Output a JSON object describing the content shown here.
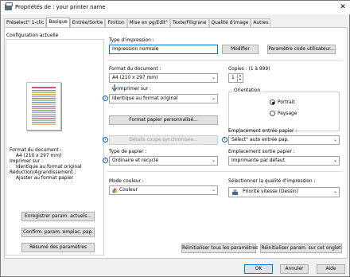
{
  "window": {
    "title": "Propriétés de : your printer name",
    "close_glyph": "✕"
  },
  "tabs": [
    {
      "label": "Préselect° 1-clic"
    },
    {
      "label": "Basique"
    },
    {
      "label": "Entrée/Sortie"
    },
    {
      "label": "Finition"
    },
    {
      "label": "Mise en pg/Edit°"
    },
    {
      "label": "Texte/Filigrane"
    },
    {
      "label": "Qualité d'image"
    },
    {
      "label": "Autres"
    }
  ],
  "left": {
    "current_config_label": "Configuration actuelle",
    "summary": [
      "Format du document :",
      "A4 (210 x 297 mm)",
      "Imprimer sur :",
      "Identique au format original",
      "Réduction/Agrandissement :",
      "Ajuster au format papier"
    ],
    "save_button": "Enregistrer param. actuels...",
    "confirm_button": "Confirm. param. emplac. pap.",
    "summary_button": "Résumé des paramètres"
  },
  "job_type": {
    "label": "Type d'impression :",
    "value": "Impression normale",
    "modify_button": "Modifier",
    "user_code_button": "Paramètre code utilisateur..."
  },
  "doc_size": {
    "label": "Format du document :",
    "value": "A4 (210 x 297 mm)"
  },
  "copies": {
    "label": "Copies : (1 à 999)",
    "value": "1"
  },
  "print_on": {
    "label": "Imprimer sur :",
    "value": "Identique au format original"
  },
  "orientation": {
    "label": "Orientation",
    "portrait": "Portrait",
    "landscape": "Paysage",
    "selected": "portrait"
  },
  "custom_size_button": "Format papier personnalisé...",
  "sync_cut_button": "Détails coupe synchronisée...",
  "input_tray": {
    "label": "Emplacement entrée papier :",
    "value": "Sélect° auto entrée pap."
  },
  "paper_type": {
    "label": "Type de papier :",
    "value": "Ordinaire et recyclé"
  },
  "output_tray": {
    "label": "Emplacement sortie papier :",
    "value": "Imprimante par défaut"
  },
  "color_mode": {
    "label": "Mode couleur :",
    "value": "Couleur"
  },
  "print_quality": {
    "label": "Sélectionner la qualité d'impression :",
    "value": "Priorité vitesse (Dessin)"
  },
  "reset_all_button": "Réinitialiser tous les paramètres",
  "reset_tab_button": "Réinitialiser param. sur cet onglet",
  "footer": {
    "ok": "OK",
    "cancel": "Annuler",
    "help": "Aide"
  },
  "icons": {
    "info": "i",
    "chevron": "⌄"
  }
}
